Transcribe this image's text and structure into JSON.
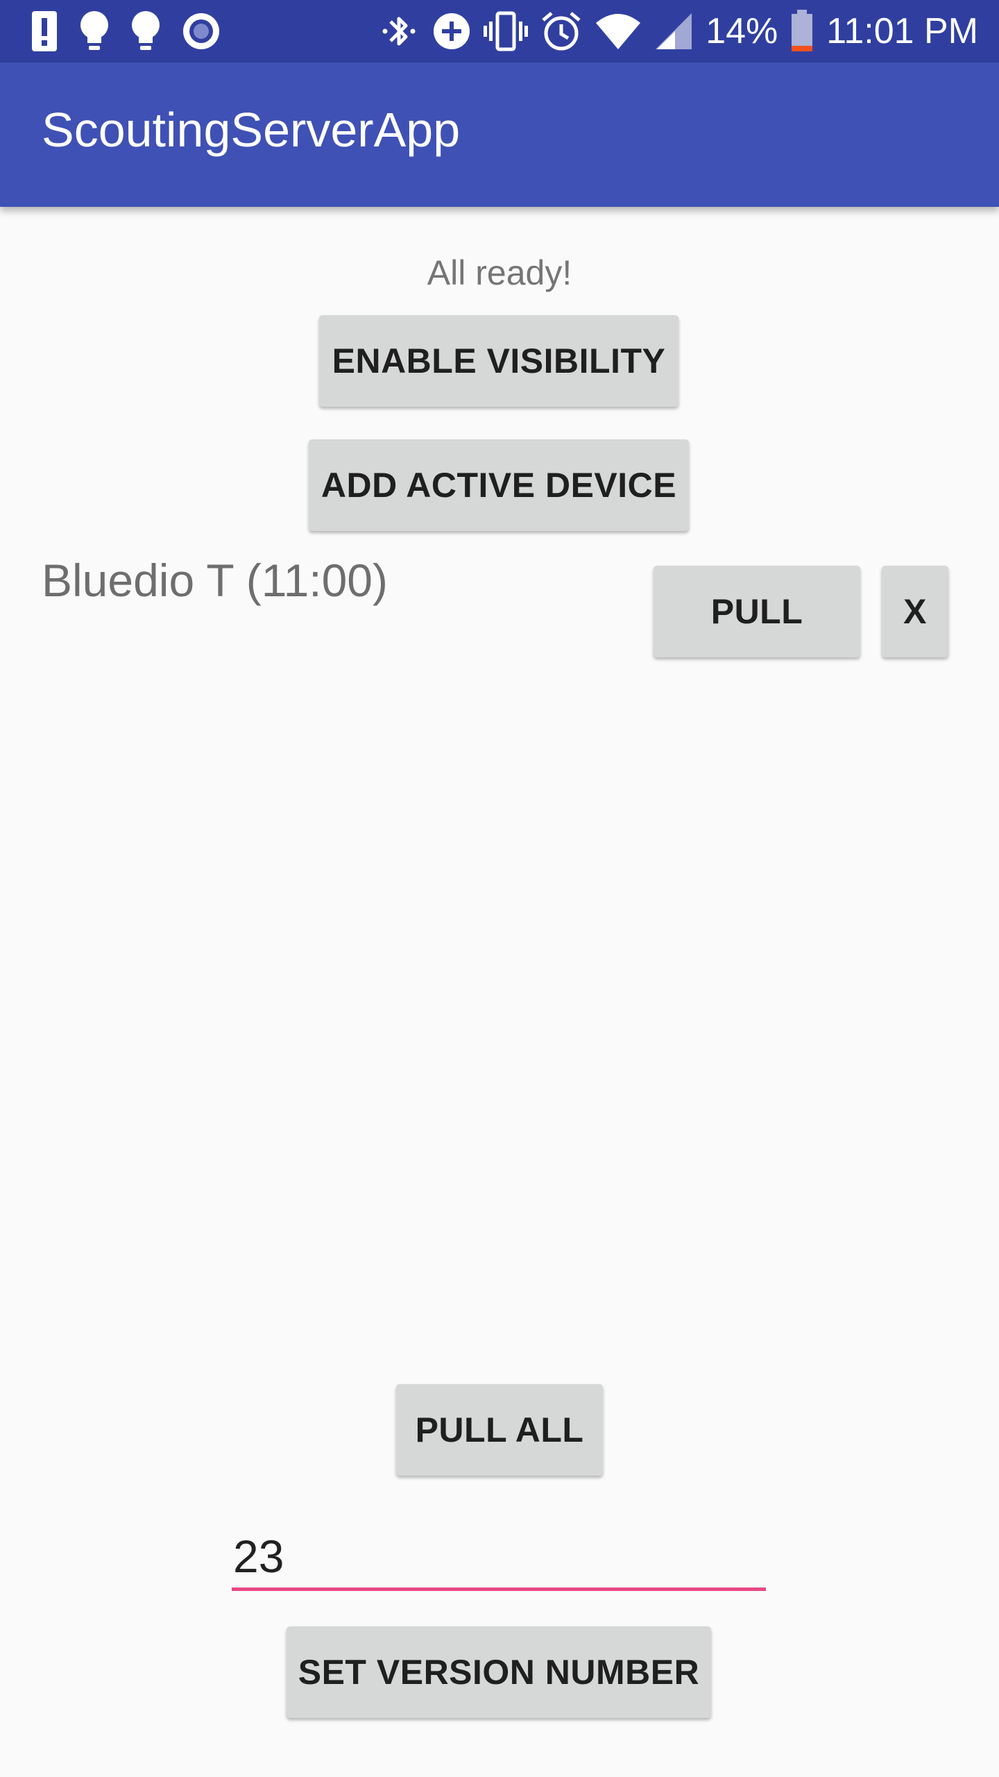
{
  "statusbar": {
    "left_icons": [
      "alert-icon",
      "lightbulb-icon",
      "lightbulb-icon",
      "record-icon"
    ],
    "right_icons": [
      "bluetooth-icon",
      "data-saver-icon",
      "vibrate-icon",
      "alarm-icon",
      "wifi-icon",
      "signal-icon",
      "battery-icon"
    ],
    "battery_percent": "14%",
    "time": "11:01 PM"
  },
  "appbar": {
    "title": "ScoutingServerApp"
  },
  "main": {
    "status": "All ready!",
    "enable_visibility_label": "ENABLE VISIBILITY",
    "add_active_device_label": "ADD ACTIVE DEVICE",
    "devices": [
      {
        "name": "Bluedio T (11:00)",
        "pull_label": "PULL",
        "remove_label": "X"
      }
    ],
    "pull_all_label": "PULL ALL",
    "version_value": "23",
    "set_version_label": "SET VERSION NUMBER"
  },
  "colors": {
    "statusbar": "#303f9f",
    "appbar": "#3f51b5",
    "accent": "#e84783",
    "button": "#d6d7d7",
    "background": "#fafafa"
  }
}
